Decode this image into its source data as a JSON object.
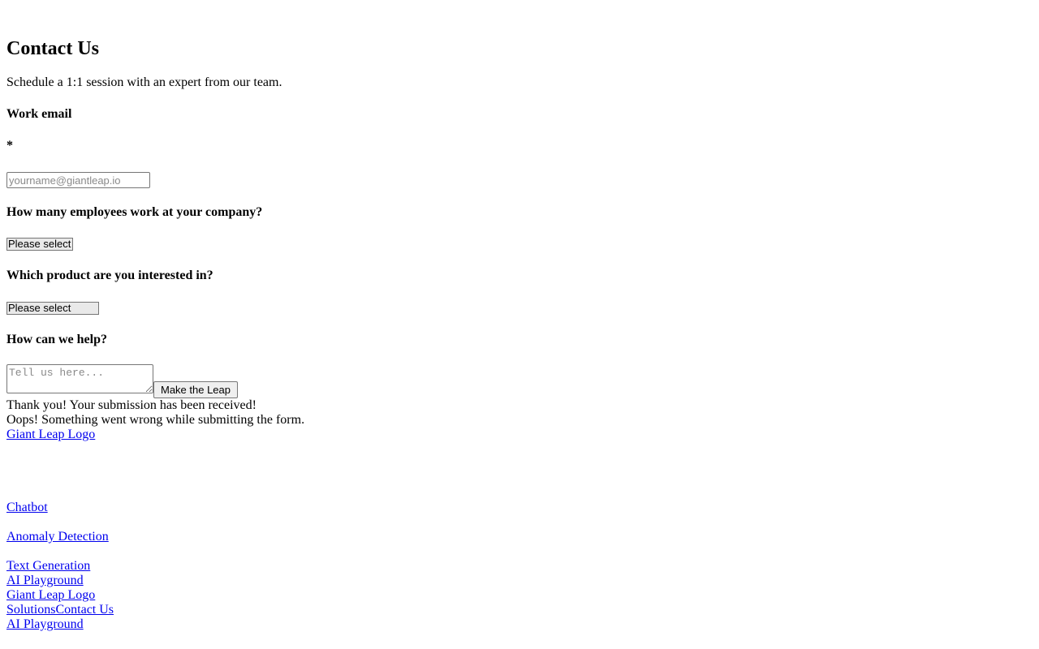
{
  "form": {
    "title": "Contact Us",
    "subtitle": "Schedule a 1:1 session with an expert from our team.",
    "email_label": "Work email",
    "required_mark": "*",
    "email_placeholder": "yourname@giantleap.io",
    "employees_label": "How many employees work at your company?",
    "employees_selected": "Please select",
    "product_label": "Which product are you interested in?",
    "product_selected": "Please select",
    "help_label": "How can we help?",
    "help_placeholder": "Tell us here...",
    "submit_label": "Make the Leap",
    "success_message": "Thank you! Your submission has been received!",
    "error_message": "Oops! Something went wrong while submitting the form."
  },
  "footer": {
    "logo_alt": "Giant Leap Logo",
    "links": [
      "Chatbot",
      "Anomaly Detection",
      "Text Generation"
    ],
    "playground_link": "AI Playground"
  },
  "nav": {
    "logo_alt": "Giant Leap Logo",
    "solutions": "Solutions",
    "contact": "Contact Us",
    "playground": "AI Playground"
  },
  "colors": {
    "link": "#0000ee",
    "text": "#000000",
    "background": "#ffffff"
  }
}
